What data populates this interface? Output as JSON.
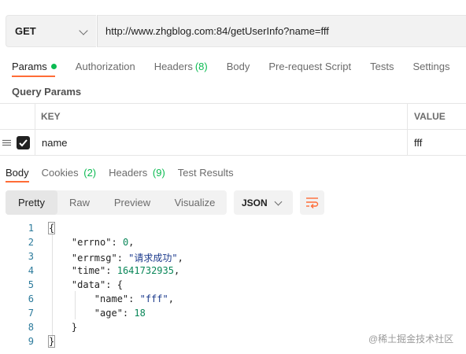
{
  "request": {
    "method": "GET",
    "url": "http://www.zhgblog.com:84/getUserInfo?name=fff"
  },
  "request_tabs": [
    {
      "label": "Params",
      "count": ""
    },
    {
      "label": "Authorization",
      "count": ""
    },
    {
      "label": "Headers",
      "count": "(8)"
    },
    {
      "label": "Body",
      "count": ""
    },
    {
      "label": "Pre-request Script",
      "count": ""
    },
    {
      "label": "Tests",
      "count": ""
    },
    {
      "label": "Settings",
      "count": ""
    }
  ],
  "query_params": {
    "title": "Query Params",
    "columns": [
      "KEY",
      "VALUE"
    ],
    "rows": [
      {
        "key": "name",
        "value": "fff",
        "checked": true
      }
    ]
  },
  "response_tabs": [
    {
      "label": "Body",
      "count": ""
    },
    {
      "label": "Cookies",
      "count": "(2)"
    },
    {
      "label": "Headers",
      "count": "(9)"
    },
    {
      "label": "Test Results",
      "count": ""
    }
  ],
  "view_modes": [
    "Pretty",
    "Raw",
    "Preview",
    "Visualize"
  ],
  "format": "JSON",
  "code_lines": [
    {
      "n": "1",
      "text": "{"
    },
    {
      "n": "2",
      "text": "    \"errno\": 0,"
    },
    {
      "n": "3",
      "text": "    \"errmsg\": \"请求成功\","
    },
    {
      "n": "4",
      "text": "    \"time\": 1641732935,"
    },
    {
      "n": "5",
      "text": "    \"data\": {"
    },
    {
      "n": "6",
      "text": "        \"name\": \"fff\","
    },
    {
      "n": "7",
      "text": "        \"age\": 18"
    },
    {
      "n": "8",
      "text": "    }"
    },
    {
      "n": "9",
      "text": "}"
    }
  ],
  "watermark": "@稀土掘金技术社区",
  "colors": {
    "accent": "#ff6c37",
    "success": "#0cbb52",
    "line_number": "#2b7a9b",
    "string": "#1b3a8c",
    "number": "#098658"
  }
}
